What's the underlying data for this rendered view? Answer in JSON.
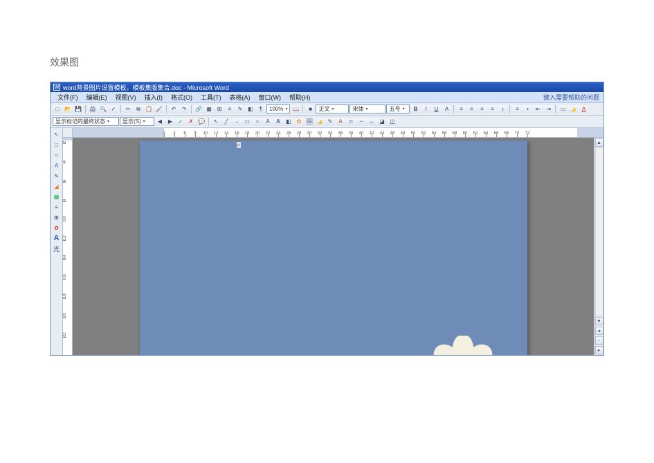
{
  "outer": {
    "caption": "效果图"
  },
  "titlebar": {
    "icon_label": "W",
    "text": "word背景图片设置模板，模板集版集合.doc - Microsoft Word"
  },
  "menu": {
    "items": [
      "文件(F)",
      "编辑(E)",
      "视图(V)",
      "插入(I)",
      "格式(O)",
      "工具(T)",
      "表格(A)",
      "窗口(W)",
      "帮助(H)"
    ],
    "help_hint": "键入需要帮助的问题"
  },
  "toolbar1": {
    "new_tip": "□",
    "open_tip": "📂",
    "save_tip": "💾",
    "print_tip": "🖨",
    "preview_tip": "🔍",
    "spell_tip": "✓",
    "cut_tip": "✂",
    "copy_tip": "⧉",
    "paste_tip": "📋",
    "format_painter_tip": "🖌",
    "undo_tip": "↶",
    "redo_tip": "↷",
    "link_tip": "🔗",
    "table_tip": "▦",
    "excel_tip": "⊞",
    "columns_tip": "≡",
    "drawing_tip": "✎",
    "map_tip": "◧",
    "para_tip": "¶",
    "zoom_value": "100%",
    "read_tip": "📖",
    "style_label": "正文",
    "styles_tip": "■",
    "font_name": "宋体",
    "font_size": "五号",
    "bold": "B",
    "italic": "I",
    "underline": "U",
    "align_l": "≡",
    "align_c": "≡",
    "align_r": "≡",
    "align_j": "≡",
    "line_sp": "↕",
    "num_list": "≡",
    "bul_list": "•",
    "indent_dec": "⇤",
    "indent_inc": "⇥",
    "border": "▭",
    "highlight": "◢",
    "font_color": "A"
  },
  "toolbar2": {
    "track_label": "显示标记的最终状态",
    "show_label": "显示(S)",
    "rev_prev": "◀",
    "rev_next": "▶",
    "rev_accept": "✓",
    "rev_reject": "✗",
    "rev_balloon": "💬",
    "draw_select": "↖",
    "draw_line": "╱",
    "draw_arrow": "→",
    "draw_rect": "▭",
    "draw_oval": "○",
    "draw_text": "A",
    "draw_wordart": "A",
    "draw_diagram": "◧",
    "draw_clip": "✿",
    "draw_pic": "🖼",
    "draw_fill": "◢",
    "draw_linecolor": "✎",
    "draw_fontcolor": "A",
    "draw_linestyle": "═",
    "draw_dash": "┄",
    "draw_arrowstyle": "↔",
    "draw_shadow": "◪",
    "draw_3d": "◫"
  },
  "side_panel": [
    "↖",
    "□",
    "○",
    "A",
    "✎",
    "◢",
    "▦",
    "≡",
    "⊞",
    "✿",
    "A",
    "光"
  ],
  "ruler": {
    "h_numbers": [
      2,
      4,
      6,
      8,
      10,
      12,
      14,
      16,
      18,
      20,
      22,
      24,
      26,
      28,
      30,
      32,
      34,
      36,
      38,
      40,
      42,
      44,
      46,
      48,
      50,
      52,
      54,
      56,
      58,
      60,
      62,
      64,
      66,
      68,
      70,
      72
    ],
    "v_numbers": [
      2,
      4,
      6,
      8,
      10,
      12,
      14,
      16,
      18,
      20,
      22
    ]
  },
  "page": {
    "cursor_hint": "⌐"
  },
  "scroll": {
    "up": "▲",
    "down": "▼",
    "page_up": "◂",
    "page_down": "▸",
    "browse": "◦"
  }
}
